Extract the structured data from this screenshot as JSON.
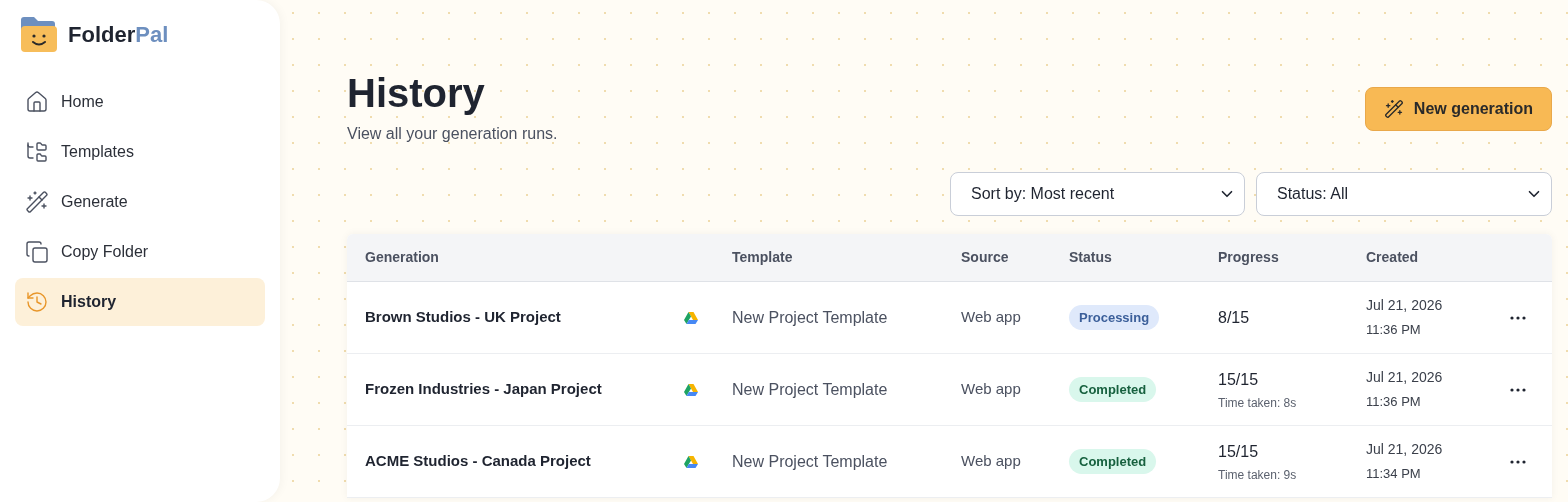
{
  "brand": {
    "name": "Folder",
    "accent": "Pal"
  },
  "sidebar": {
    "items": [
      {
        "label": "Home",
        "selected": false
      },
      {
        "label": "Templates",
        "selected": false
      },
      {
        "label": "Generate",
        "selected": false
      },
      {
        "label": "Copy Folder",
        "selected": false
      },
      {
        "label": "History",
        "selected": true
      }
    ]
  },
  "header": {
    "title": "History",
    "subtitle": "View all your generation runs.",
    "button": "New generation"
  },
  "filters": [
    {
      "value": "Sort by: Most recent"
    },
    {
      "value": "Status: All"
    }
  ],
  "table": {
    "columns": [
      "Generation",
      "",
      "Template",
      "Source",
      "Status",
      "Progress",
      "Created"
    ],
    "rows": [
      {
        "generation": "Brown Studios - UK Project",
        "template": "New Project Template",
        "source": "Web app",
        "status": {
          "label": "Processing",
          "kind": "processing"
        },
        "progress": "8/15",
        "date": "Jul 21, 2026",
        "time": "11:36 PM"
      },
      {
        "generation": "Frozen Industries - Japan Project",
        "template": "New Project Template",
        "source": "Web app",
        "status": {
          "label": "Completed",
          "kind": "completed"
        },
        "progress": "15/15",
        "time_taken": "Time taken: 8s",
        "date": "Jul 21, 2026",
        "time": "11:36 PM"
      },
      {
        "generation": "ACME Studios - Canada Project",
        "template": "New Project Template",
        "source": "Web app",
        "status": {
          "label": "Completed",
          "kind": "completed"
        },
        "progress": "15/15",
        "time_taken": "Time taken: 9s",
        "date": "Jul 21, 2026",
        "time": "11:34 PM"
      }
    ]
  }
}
